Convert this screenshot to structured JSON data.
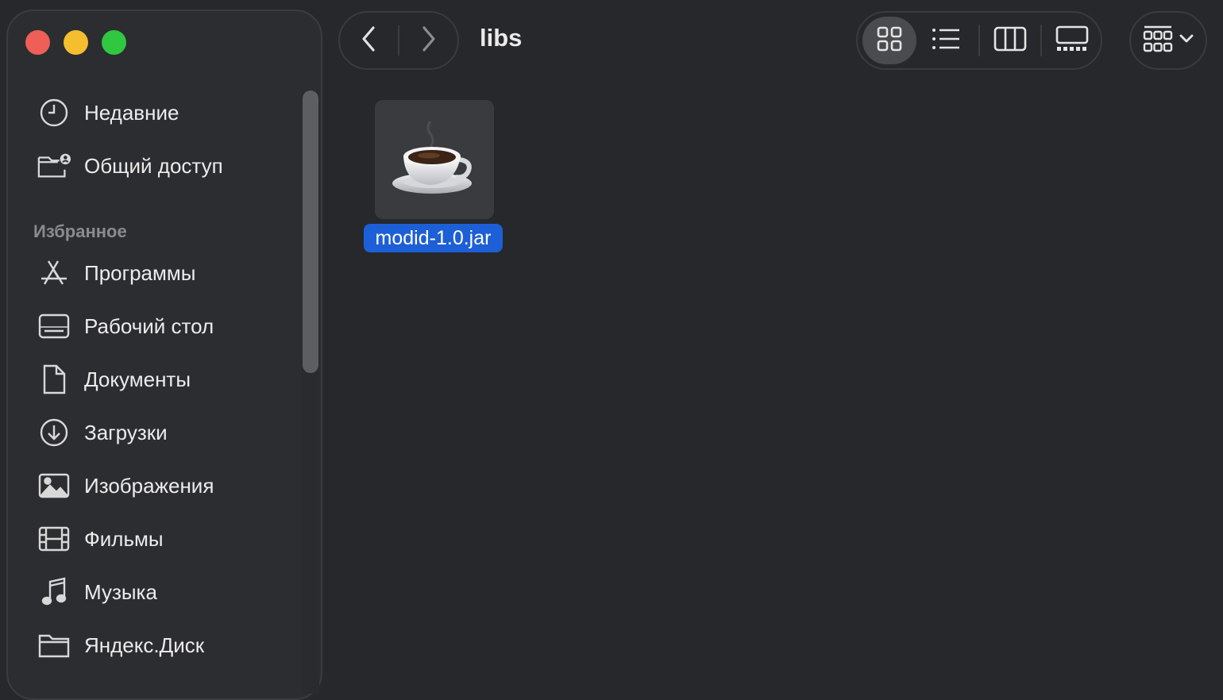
{
  "window": {
    "traffic_lights": {
      "close_color": "#ed5f57",
      "minimize_color": "#f5be2f",
      "zoom_color": "#2fc840"
    }
  },
  "toolbar": {
    "title": "libs",
    "back_icon": "chevron-left-icon",
    "forward_icon": "chevron-right-icon",
    "views": [
      {
        "name": "icons",
        "icon": "grid-icon",
        "active": true
      },
      {
        "name": "list",
        "icon": "list-icon",
        "active": false
      },
      {
        "name": "columns",
        "icon": "columns-icon",
        "active": false
      },
      {
        "name": "gallery",
        "icon": "gallery-icon",
        "active": false
      }
    ],
    "group_icon": "group-grid-icon"
  },
  "sidebar": {
    "top_items": [
      {
        "label": "Недавние",
        "icon": "clock-icon"
      },
      {
        "label": "Общий доступ",
        "icon": "shared-folder-icon"
      }
    ],
    "favorites_title": "Избранное",
    "favorites": [
      {
        "label": "Программы",
        "icon": "applications-icon"
      },
      {
        "label": "Рабочий стол",
        "icon": "desktop-icon"
      },
      {
        "label": "Документы",
        "icon": "document-icon"
      },
      {
        "label": "Загрузки",
        "icon": "download-icon"
      },
      {
        "label": "Изображения",
        "icon": "photos-icon"
      },
      {
        "label": "Фильмы",
        "icon": "film-icon"
      },
      {
        "label": "Музыка",
        "icon": "music-icon"
      },
      {
        "label": "Яндекс.Диск",
        "icon": "folder-icon"
      }
    ]
  },
  "files": [
    {
      "name": "modid-1.0.jar",
      "icon": "java-coffee-cup-icon",
      "selected": true
    }
  ],
  "colors": {
    "selection": "#1d5fd6",
    "background": "#26282b",
    "sidebar": "#2c2d30"
  }
}
